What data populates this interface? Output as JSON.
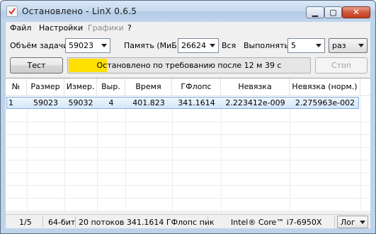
{
  "window": {
    "title": "Остановлено - LinX 0.6.5",
    "app_icon": "checkbox-icon",
    "min_icon": "minimize-icon",
    "max_icon": "maximize-icon",
    "close_icon": "close-icon"
  },
  "menu": {
    "items": [
      {
        "label": "Файл",
        "enabled": true
      },
      {
        "label": "Настройки",
        "enabled": true
      },
      {
        "label": "Графики",
        "enabled": false
      },
      {
        "label": "?",
        "enabled": true
      }
    ]
  },
  "controls": {
    "problem_size_label": "Объём задачи:",
    "problem_size_value": "59023",
    "memory_label": "Память (МиБ):",
    "memory_value": "26624",
    "memory_suffix": "Вся",
    "run_label": "Выполнять:",
    "run_value": "5",
    "run_unit": "раз"
  },
  "actions": {
    "test_label": "Тест",
    "stop_label": "Стоп",
    "stop_enabled": false
  },
  "progress": {
    "text": "Остановлено по требованию после 12 м 39 с",
    "fraction": 0.16,
    "color": "#ffe000"
  },
  "table": {
    "headers": [
      "№",
      "Размер",
      "Измер.",
      "Выр.",
      "Время",
      "ГФлопс",
      "Невязка",
      "Невязка (норм.)"
    ],
    "rows": [
      [
        "1",
        "59023",
        "59032",
        "4",
        "401.823",
        "341.1614",
        "2.223412e-009",
        "2.275963e-002"
      ]
    ]
  },
  "status": {
    "progress_count": "1/5",
    "bitness": "64-бит",
    "summary": "20 потоков 341.1614 ГФлопс пик",
    "cpu": "Intel® Core™ i7-6950X",
    "log_label": "Лог"
  }
}
